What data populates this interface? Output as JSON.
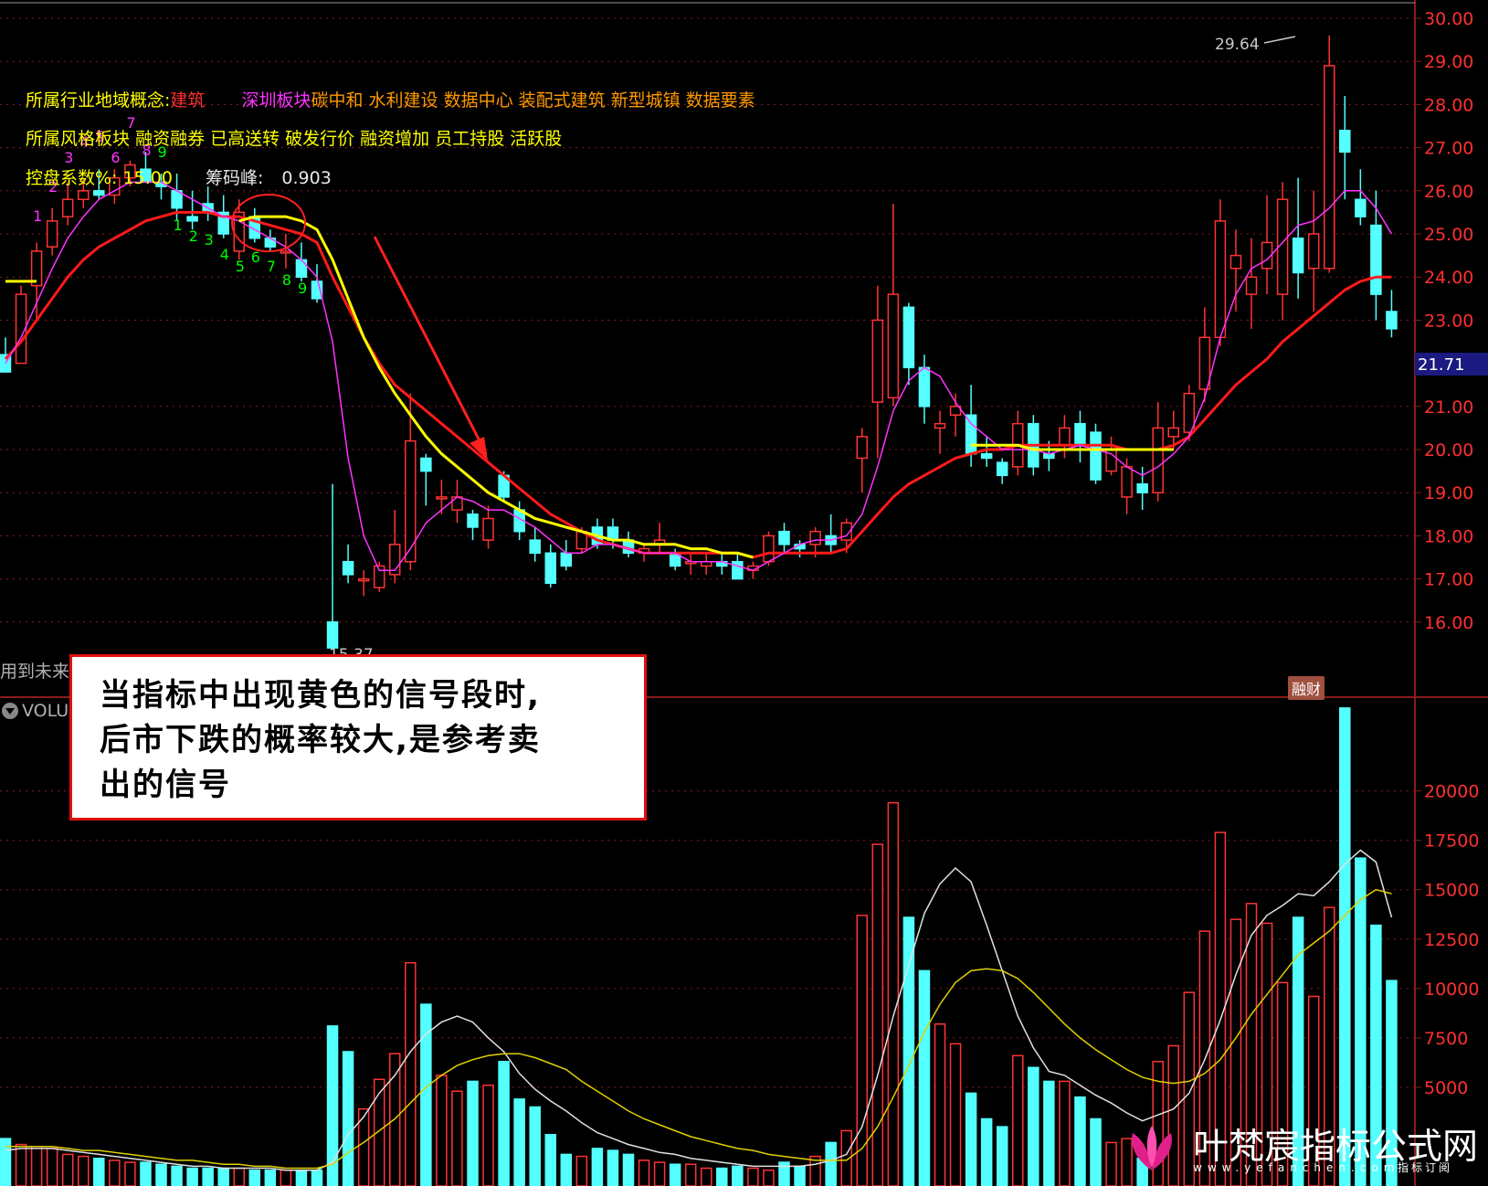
{
  "info": {
    "line1_label": "所属行业地域概念:",
    "line1_industry": "建筑",
    "line1_region": "深圳板块",
    "line1_concepts": "碳中和 水利建设 数据中心 装配式建筑 新型城镇 数据要素",
    "line2_label": "所属风格板块",
    "line2_styles": "融资融券 已高送转 破发行价 融资增加 员工持股 活跃股",
    "line3_label": "控盘系数%:",
    "line3_value": "15.00",
    "line3_label2": "筹码峰:",
    "line3_value2": "0.903"
  },
  "callout": {
    "line1": "当指标中出现黄色的信号段时,",
    "line2": "后市下跌的概率较大,是参考卖",
    "line3": "出的信号"
  },
  "left_cut": {
    "text1": "用到未来",
    "text2": "VOLU"
  },
  "badge": "融财",
  "watermark": {
    "name": "叶梵宸指标公式网",
    "url": "www.yefanchen.com",
    "tag": "指标订阅"
  },
  "colors": {
    "up": "#ff3333",
    "down": "#54ffff",
    "yellow_line": "#ffff00",
    "red_line": "#ff1a1a",
    "magenta_line": "#ff33ff",
    "grid": "#8a1c1c"
  },
  "chart_data": [
    {
      "type": "candlestick",
      "price_ticks": [
        "30.00",
        "29.00",
        "28.00",
        "27.00",
        "26.00",
        "25.00",
        "24.00",
        "23.00",
        "21.00",
        "20.00",
        "19.00",
        "18.00",
        "17.00",
        "16.00"
      ],
      "ylim": [
        15.2,
        30.2
      ],
      "current_price": "21.71",
      "annotations": {
        "high_label": "29.64",
        "low_label": "15.37"
      },
      "candles": [
        [
          22.2,
          22.6,
          21.8,
          21.8
        ],
        [
          22.0,
          23.8,
          22.0,
          23.6
        ],
        [
          23.8,
          24.8,
          23.0,
          24.6
        ],
        [
          24.7,
          25.6,
          24.5,
          25.3
        ],
        [
          25.4,
          26.2,
          25.2,
          25.8
        ],
        [
          25.8,
          26.3,
          25.6,
          26.0
        ],
        [
          26.0,
          26.5,
          25.8,
          25.9
        ],
        [
          25.9,
          26.5,
          25.7,
          26.3
        ],
        [
          26.3,
          26.7,
          26.1,
          26.6
        ],
        [
          26.5,
          26.9,
          26.2,
          26.2
        ],
        [
          26.2,
          26.4,
          25.8,
          26.1
        ],
        [
          26.0,
          26.4,
          25.3,
          25.6
        ],
        [
          25.4,
          26.0,
          25.1,
          25.3
        ],
        [
          25.7,
          26.1,
          25.3,
          25.5
        ],
        [
          25.5,
          25.9,
          24.9,
          25.0
        ],
        [
          24.6,
          25.8,
          24.4,
          25.5
        ],
        [
          25.4,
          25.6,
          24.8,
          24.9
        ],
        [
          24.9,
          25.1,
          24.6,
          24.7
        ],
        [
          24.6,
          25.0,
          24.2,
          24.6
        ],
        [
          24.4,
          24.8,
          23.9,
          24.0
        ],
        [
          23.9,
          24.3,
          23.4,
          23.5
        ],
        [
          16.0,
          19.2,
          15.4,
          15.4
        ],
        [
          17.4,
          17.8,
          16.9,
          17.1
        ],
        [
          17.0,
          17.2,
          16.6,
          17.0
        ],
        [
          16.8,
          17.4,
          16.7,
          17.3
        ],
        [
          17.1,
          18.6,
          16.9,
          17.8
        ],
        [
          17.4,
          21.3,
          17.2,
          20.2
        ],
        [
          19.8,
          19.9,
          18.7,
          19.5
        ],
        [
          18.9,
          19.3,
          18.5,
          18.9
        ],
        [
          18.6,
          19.3,
          18.3,
          18.9
        ],
        [
          18.5,
          18.6,
          17.9,
          18.2
        ],
        [
          17.9,
          18.7,
          17.7,
          18.4
        ],
        [
          19.4,
          19.5,
          18.8,
          18.9
        ],
        [
          18.6,
          18.8,
          17.9,
          18.1
        ],
        [
          17.9,
          18.2,
          17.4,
          17.6
        ],
        [
          17.6,
          17.8,
          16.8,
          16.9
        ],
        [
          17.6,
          17.9,
          17.2,
          17.3
        ],
        [
          17.7,
          18.2,
          17.6,
          18.1
        ],
        [
          18.2,
          18.4,
          17.7,
          17.8
        ],
        [
          18.2,
          18.4,
          17.7,
          17.9
        ],
        [
          17.9,
          18.1,
          17.5,
          17.6
        ],
        [
          17.6,
          17.8,
          17.4,
          17.7
        ],
        [
          17.8,
          18.3,
          17.6,
          17.9
        ],
        [
          17.6,
          17.7,
          17.2,
          17.3
        ],
        [
          17.4,
          17.6,
          17.1,
          17.4
        ],
        [
          17.3,
          17.6,
          17.1,
          17.4
        ],
        [
          17.4,
          17.6,
          17.1,
          17.3
        ],
        [
          17.4,
          17.6,
          17.0,
          17.0
        ],
        [
          17.2,
          17.4,
          17.0,
          17.3
        ],
        [
          17.4,
          18.1,
          17.3,
          18.0
        ],
        [
          18.1,
          18.3,
          17.6,
          17.8
        ],
        [
          17.8,
          17.9,
          17.5,
          17.7
        ],
        [
          17.8,
          18.2,
          17.5,
          18.1
        ],
        [
          18.0,
          18.5,
          17.6,
          17.8
        ],
        [
          17.9,
          18.4,
          17.6,
          18.3
        ],
        [
          19.8,
          20.5,
          19.0,
          20.3
        ],
        [
          21.1,
          23.8,
          19.8,
          23.0
        ],
        [
          21.2,
          25.7,
          21.0,
          23.6
        ],
        [
          23.3,
          23.4,
          21.5,
          21.9
        ],
        [
          21.9,
          22.2,
          20.6,
          21.0
        ],
        [
          20.5,
          20.9,
          19.9,
          20.6
        ],
        [
          20.8,
          21.3,
          20.3,
          21.0
        ],
        [
          20.8,
          21.5,
          19.6,
          19.9
        ],
        [
          19.9,
          20.3,
          19.6,
          19.8
        ],
        [
          19.7,
          19.8,
          19.2,
          19.4
        ],
        [
          19.6,
          20.9,
          19.4,
          20.6
        ],
        [
          20.6,
          20.8,
          19.4,
          19.6
        ],
        [
          19.9,
          20.2,
          19.5,
          19.8
        ],
        [
          20.1,
          20.8,
          19.8,
          20.5
        ],
        [
          20.6,
          20.9,
          19.7,
          20.1
        ],
        [
          20.4,
          20.6,
          19.2,
          19.3
        ],
        [
          19.5,
          20.3,
          19.4,
          20.0
        ],
        [
          18.9,
          19.8,
          18.5,
          19.6
        ],
        [
          19.2,
          19.6,
          18.6,
          19.0
        ],
        [
          19.0,
          21.1,
          18.8,
          20.5
        ],
        [
          20.3,
          20.9,
          20.0,
          20.5
        ],
        [
          20.4,
          21.5,
          20.2,
          21.3
        ],
        [
          21.4,
          23.3,
          21.1,
          22.6
        ],
        [
          22.6,
          25.8,
          22.4,
          25.3
        ],
        [
          24.2,
          25.1,
          23.2,
          24.5
        ],
        [
          23.6,
          24.9,
          22.8,
          24.0
        ],
        [
          24.2,
          25.9,
          23.6,
          24.8
        ],
        [
          23.6,
          26.2,
          23.0,
          25.8
        ],
        [
          24.9,
          26.3,
          23.5,
          24.1
        ],
        [
          24.2,
          26.0,
          23.2,
          25.0
        ],
        [
          24.2,
          29.6,
          24.1,
          28.9
        ],
        [
          27.4,
          28.2,
          25.8,
          26.9
        ],
        [
          25.8,
          26.5,
          25.2,
          25.4
        ],
        [
          25.2,
          26.0,
          23.0,
          23.6
        ],
        [
          23.2,
          23.7,
          22.6,
          22.8
        ]
      ],
      "lines": {
        "ma_red": [
          22.1,
          22.5,
          23.0,
          23.5,
          24.0,
          24.4,
          24.7,
          24.9,
          25.1,
          25.3,
          25.4,
          25.5,
          25.5,
          25.5,
          25.4,
          25.4,
          25.3,
          25.2,
          25.1,
          25.0,
          24.8,
          24.0,
          23.3,
          22.6,
          22.0,
          21.5,
          21.2,
          20.9,
          20.6,
          20.3,
          20.0,
          19.7,
          19.4,
          19.1,
          18.8,
          18.5,
          18.3,
          18.1,
          17.9,
          17.8,
          17.7,
          17.6,
          17.6,
          17.6,
          17.6,
          17.6,
          17.6,
          17.6,
          17.5,
          17.6,
          17.6,
          17.6,
          17.6,
          17.6,
          17.7,
          18.1,
          18.5,
          18.9,
          19.2,
          19.4,
          19.6,
          19.8,
          19.9,
          20.0,
          20.0,
          20.1,
          20.1,
          20.1,
          20.1,
          20.1,
          20.1,
          20.1,
          20.0,
          20.0,
          20.0,
          20.1,
          20.3,
          20.7,
          21.1,
          21.5,
          21.8,
          22.1,
          22.5,
          22.8,
          23.1,
          23.4,
          23.7,
          23.9,
          24.0,
          24.0
        ],
        "ma_magenta": [
          22.0,
          22.6,
          23.4,
          24.2,
          24.9,
          25.4,
          25.8,
          26.0,
          26.2,
          26.2,
          26.2,
          26.0,
          25.8,
          25.6,
          25.4,
          25.3,
          25.1,
          24.9,
          24.7,
          24.4,
          24.0,
          22.5,
          19.8,
          18.0,
          17.2,
          17.2,
          17.7,
          18.3,
          18.6,
          18.9,
          18.8,
          18.6,
          18.6,
          18.4,
          18.2,
          17.9,
          17.6,
          17.6,
          17.8,
          17.8,
          17.7,
          17.6,
          17.6,
          17.6,
          17.4,
          17.4,
          17.4,
          17.3,
          17.2,
          17.4,
          17.6,
          17.8,
          17.9,
          17.9,
          18.0,
          18.5,
          19.6,
          20.9,
          21.6,
          21.9,
          21.7,
          21.1,
          20.6,
          20.3,
          20.0,
          20.0,
          20.0,
          19.9,
          20.0,
          20.1,
          20.0,
          19.9,
          19.6,
          19.4,
          19.6,
          19.9,
          20.3,
          21.2,
          22.6,
          23.6,
          24.2,
          24.4,
          24.8,
          25.2,
          25.3,
          25.6,
          26.0,
          26.0,
          25.6,
          25.0
        ],
        "ma_yellow": [
          23.9,
          23.9,
          23.9,
          null,
          null,
          null,
          null,
          null,
          null,
          null,
          null,
          null,
          null,
          null,
          null,
          25.3,
          25.4,
          25.4,
          25.4,
          25.3,
          25.1,
          24.4,
          23.5,
          22.6,
          21.9,
          21.3,
          20.8,
          20.3,
          19.9,
          19.6,
          19.3,
          19.0,
          18.8,
          18.6,
          18.4,
          18.3,
          18.2,
          18.1,
          18.0,
          17.9,
          17.9,
          17.8,
          17.8,
          17.8,
          17.7,
          17.7,
          17.6,
          17.6,
          17.5,
          null,
          null,
          null,
          null,
          null,
          null,
          null,
          null,
          null,
          null,
          null,
          null,
          null,
          20.1,
          20.1,
          20.1,
          20.1,
          20.0,
          20.0,
          20.0,
          20.0,
          20.0,
          20.0,
          20.0,
          20.0,
          20.0,
          20.0,
          null,
          null,
          null,
          null,
          null,
          null,
          null,
          null,
          null,
          null,
          null,
          null,
          null,
          null
        ]
      },
      "count_labels_green": [
        "1",
        "2",
        "3",
        "4",
        "5",
        "6",
        "7",
        "8",
        "9"
      ],
      "count_labels_magenta": [
        "1",
        "2",
        "3",
        "4",
        "5",
        "6",
        "7",
        "8",
        "9"
      ]
    },
    {
      "type": "bar",
      "title": "VOLU",
      "volume_ticks": [
        "20000",
        "17500",
        "15000",
        "12500",
        "10000",
        "7500",
        "5000"
      ],
      "ylim": [
        0,
        23500
      ],
      "volumes": [
        2400,
        2100,
        2000,
        1900,
        1600,
        1500,
        1400,
        1300,
        1200,
        1200,
        1100,
        1000,
        900,
        900,
        900,
        900,
        800,
        800,
        800,
        800,
        800,
        8100,
        6800,
        3900,
        5400,
        6700,
        11300,
        9200,
        5600,
        4800,
        5300,
        5100,
        6300,
        4400,
        4000,
        2600,
        1600,
        1500,
        1900,
        1800,
        1600,
        1300,
        1200,
        1100,
        1100,
        900,
        900,
        1000,
        900,
        800,
        1200,
        1000,
        1500,
        2200,
        2800,
        13700,
        17300,
        19400,
        13600,
        10900,
        8200,
        7200,
        4700,
        3400,
        3000,
        6600,
        6000,
        5300,
        5300,
        4500,
        3400,
        2200,
        2400,
        1400,
        6300,
        7100,
        9800,
        12900,
        17900,
        13500,
        14300,
        13300,
        10300,
        13600,
        9600,
        14100,
        24200,
        16600,
        13200,
        10400
      ],
      "ma_white": [
        1800,
        1900,
        1900,
        1900,
        1800,
        1700,
        1600,
        1500,
        1400,
        1300,
        1200,
        1100,
        1000,
        1000,
        900,
        900,
        900,
        900,
        800,
        800,
        800,
        1200,
        2600,
        3500,
        4700,
        5600,
        6800,
        7700,
        8300,
        8600,
        8300,
        7500,
        6800,
        5700,
        4900,
        4300,
        3800,
        3200,
        2700,
        2400,
        2100,
        1900,
        1700,
        1600,
        1400,
        1300,
        1200,
        1100,
        1000,
        1000,
        1000,
        1000,
        1100,
        1300,
        1600,
        3000,
        5600,
        8600,
        11200,
        13800,
        15300,
        16100,
        15400,
        13200,
        10900,
        8600,
        7000,
        5800,
        5600,
        5100,
        4600,
        4200,
        3700,
        3300,
        3600,
        3900,
        4700,
        6400,
        8400,
        10700,
        12700,
        13700,
        14200,
        14800,
        14700,
        15400,
        16300,
        17000,
        16400,
        13600
      ],
      "ma_yellow": [
        2000,
        2000,
        2000,
        2000,
        1900,
        1800,
        1800,
        1700,
        1600,
        1500,
        1400,
        1300,
        1300,
        1200,
        1100,
        1100,
        1000,
        1000,
        900,
        900,
        900,
        1100,
        1700,
        2200,
        2800,
        3400,
        4200,
        5000,
        5600,
        6100,
        6400,
        6600,
        6700,
        6700,
        6500,
        6200,
        5900,
        5300,
        4800,
        4300,
        3800,
        3400,
        3100,
        2800,
        2500,
        2300,
        2100,
        1900,
        1800,
        1600,
        1500,
        1400,
        1300,
        1300,
        1300,
        1900,
        3000,
        4500,
        6100,
        7800,
        9200,
        10300,
        10900,
        11000,
        10900,
        10500,
        9800,
        9000,
        8200,
        7500,
        6900,
        6400,
        5900,
        5500,
        5300,
        5200,
        5300,
        5700,
        6400,
        7500,
        8700,
        9700,
        10700,
        11700,
        12300,
        12900,
        13700,
        14500,
        15000,
        14800
      ]
    }
  ]
}
